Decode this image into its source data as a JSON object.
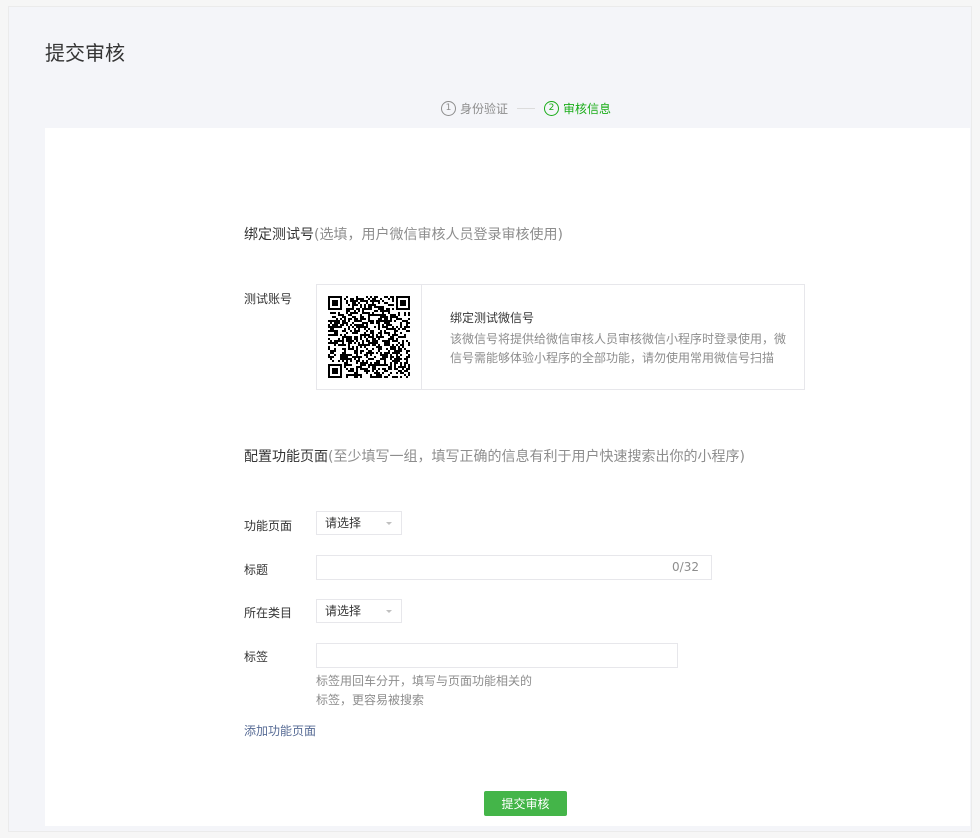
{
  "page": {
    "title": "提交审核"
  },
  "steps": [
    {
      "num": "1",
      "label": "身份验证",
      "active": false
    },
    {
      "num": "2",
      "label": "审核信息",
      "active": true
    }
  ],
  "test_account_section": {
    "title": "绑定测试号",
    "hint": "(选填，用户微信审核人员登录审核使用)",
    "field_label": "测试账号",
    "qr_title": "绑定测试微信号",
    "qr_description": "该微信号将提供给微信审核人员审核微信小程序时登录使用，微信号需能够体验小程序的全部功能，请勿使用常用微信号扫描"
  },
  "config_section": {
    "title": "配置功能页面",
    "hint": "(至少填写一组，填写正确的信息有利于用户快速搜索出你的小程序)",
    "fields": {
      "function_page": {
        "label": "功能页面",
        "value": "请选择"
      },
      "title": {
        "label": "标题",
        "value": "",
        "counter": "0/32"
      },
      "category": {
        "label": "所在类目",
        "value": "请选择"
      },
      "tags": {
        "label": "标签",
        "value": "",
        "hint_line1": "标签用回车分开，填写与页面功能相关的",
        "hint_line2": "标签，更容易被搜索"
      }
    },
    "add_link": "添加功能页面"
  },
  "submit": {
    "label": "提交审核"
  },
  "colors": {
    "accent": "#1aad19",
    "button": "#44b549",
    "link": "#576b95"
  }
}
